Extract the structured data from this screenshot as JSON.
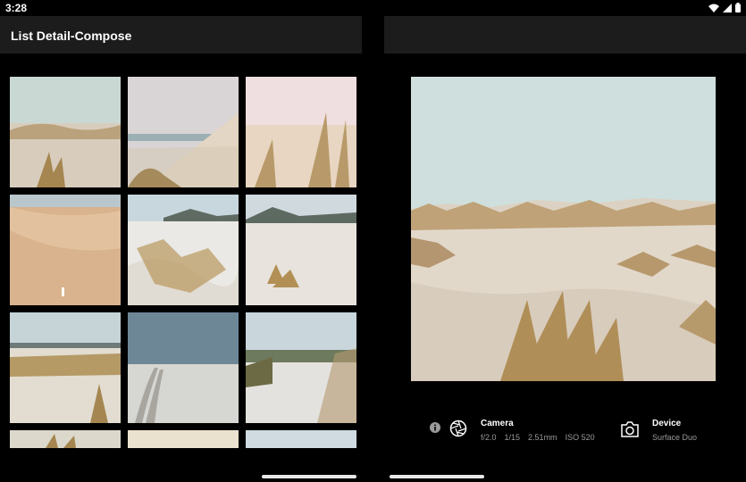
{
  "status": {
    "time": "3:28",
    "icons": [
      "wifi-icon",
      "signal-icon",
      "battery-icon"
    ]
  },
  "app": {
    "title": "List Detail-Compose"
  },
  "gallery": {
    "tiles": [
      {
        "name": "photo-dunes-1"
      },
      {
        "name": "photo-dunes-2"
      },
      {
        "name": "photo-dunes-3"
      },
      {
        "name": "photo-dunes-4"
      },
      {
        "name": "photo-dunes-5"
      },
      {
        "name": "photo-dunes-6"
      },
      {
        "name": "photo-dunes-7"
      },
      {
        "name": "photo-dunes-8"
      },
      {
        "name": "photo-dunes-9"
      },
      {
        "name": "photo-dunes-10"
      },
      {
        "name": "photo-dunes-11"
      },
      {
        "name": "photo-dunes-12"
      }
    ]
  },
  "details": {
    "info_icon": "info-icon",
    "camera": {
      "icon": "aperture-icon",
      "label": "Camera",
      "aperture": "f/2.0",
      "shutter": "1/15",
      "focal": "2.51mm",
      "iso": "ISO 520"
    },
    "device": {
      "icon": "camera-icon",
      "label": "Device",
      "model": "Surface Duo"
    }
  },
  "colors": {
    "appbar": "#1c1c1c",
    "background": "#000000",
    "subtext": "#9a9a9a"
  }
}
